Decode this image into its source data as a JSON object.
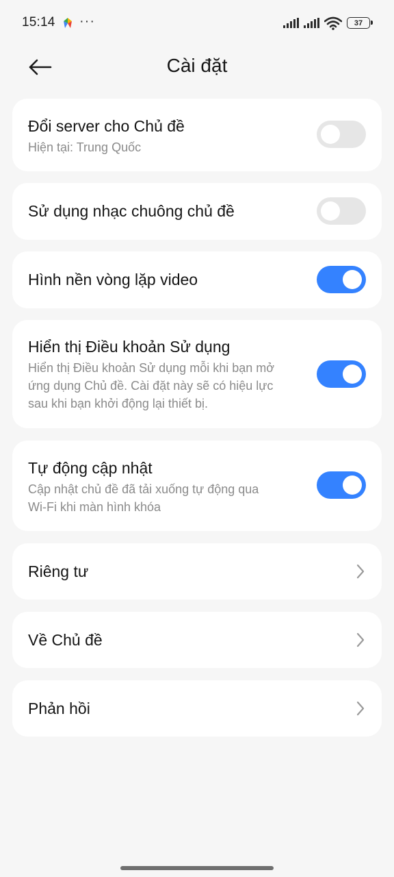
{
  "status_bar": {
    "time": "15:14",
    "more_indicator": "···",
    "battery_level": "37",
    "icons": [
      "app-notification-icon",
      "signal-icon",
      "signal-icon",
      "wifi-icon",
      "battery-icon"
    ]
  },
  "header": {
    "back_icon": "arrow-left-icon",
    "title": "Cài đặt"
  },
  "settings": {
    "server": {
      "title": "Đổi server cho Chủ đề",
      "subtitle": "Hiện tại: Trung Quốc",
      "enabled": false
    },
    "ringtone": {
      "title": "Sử dụng nhạc chuông chủ đề",
      "enabled": false
    },
    "video_wallpaper": {
      "title": "Hình nền vòng lặp video",
      "enabled": true
    },
    "terms": {
      "title": "Hiển thị Điều khoản Sử dụng",
      "subtitle_lines": [
        "Hiển thị Điều khoản Sử dụng mỗi khi bạn mở",
        "ứng dụng Chủ đề. Cài đặt này sẽ có hiệu lực",
        "sau khi bạn khởi động lại thiết bị."
      ],
      "enabled": true
    },
    "auto_update": {
      "title": "Tự động cập nhật",
      "subtitle_lines": [
        "Cập nhật chủ đề đã tải xuống tự động qua",
        "Wi-Fi khi màn hình khóa"
      ],
      "enabled": true
    },
    "privacy": {
      "title": "Riêng tư"
    },
    "about": {
      "title": "Về Chủ đề"
    },
    "feedback": {
      "title": "Phản hồi"
    }
  },
  "colors": {
    "background": "#f6f6f6",
    "card": "#ffffff",
    "toggle_on": "#3482ff",
    "toggle_off": "#e6e6e6",
    "subtitle": "#8a8a8a"
  }
}
